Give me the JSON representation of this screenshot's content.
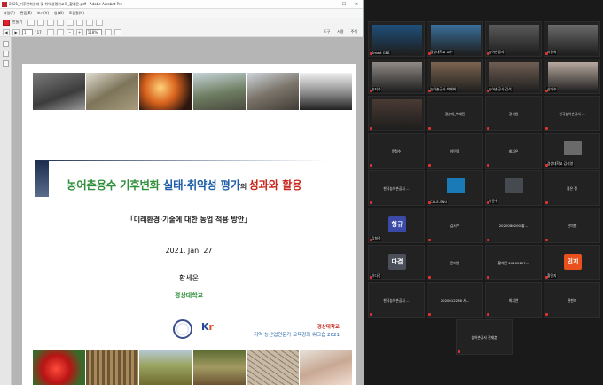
{
  "acrobat": {
    "title": "2021_기후변화실태 및 취약성평가교육_황세운.pdf - Adobe Acrobat Pro",
    "menu": [
      "파일(F)",
      "편집(E)",
      "보기(V)",
      "창(W)",
      "도움말(H)"
    ],
    "toolbar": {
      "create_label": "만들기",
      "page_current": "1",
      "page_total": "/ 17",
      "zoom": "118%",
      "right_items": [
        "도구",
        "서명",
        "주석"
      ]
    }
  },
  "slide": {
    "title_part1": "농어촌용수 기후변화 ",
    "title_part2": "실태·취약성 평가",
    "title_part3": "의 ",
    "title_part4": "성과와 활용",
    "subtitle": "「미래환경·기술에 대한 농업 적용 방안」",
    "date": "2021. Jan. 27",
    "author": "황세운",
    "affiliation": "경상대학교",
    "kr_logo_left": "K",
    "kr_logo_right": "r",
    "org_line1": "경상대학교",
    "org_line2": "지역 농산업전문가 교육강좌 워크숍 2021"
  },
  "zoom": {
    "tiles": [
      {
        "name": "Smart GBS",
        "type": "video",
        "color": "#1f4f7a"
      },
      {
        "name": "경상대학교 교수",
        "type": "video",
        "color": "#3a6f9a"
      },
      {
        "name": "농어촌공사",
        "type": "video",
        "color": "#5a5a5a"
      },
      {
        "name": "박중희",
        "type": "video",
        "color": "#6a6a6a"
      },
      {
        "name": "송지수",
        "type": "video",
        "color": "#8f8a86"
      },
      {
        "name": "농어촌공사 박재희",
        "type": "video",
        "color": "#7c6450"
      },
      {
        "name": "농어촌공사 김석",
        "type": "video",
        "color": "#6f5e53"
      },
      {
        "name": "신미수",
        "type": "video",
        "color": "#b8a9a0"
      },
      {
        "name": "",
        "type": "video",
        "color": "#4a3a33"
      },
      {
        "name": "경상대_박재민",
        "type": "name"
      },
      {
        "name": "강석원",
        "type": "name"
      },
      {
        "name": "한국농어촌공사 ...",
        "type": "name"
      },
      {
        "name": "문정수",
        "type": "name"
      },
      {
        "name": "이민정",
        "type": "name"
      },
      {
        "name": "최지은",
        "type": "name"
      },
      {
        "name": "경상대학교 김석영",
        "type": "thumb",
        "color": "#6a6a6a"
      },
      {
        "name": "한국농어촌공사 ...",
        "type": "name"
      },
      {
        "name": "CALE-SNU",
        "type": "thumb",
        "color": "#1a7ab8"
      },
      {
        "name": "이준우",
        "type": "thumb",
        "color": "#444a50"
      },
      {
        "name": "황은 정",
        "type": "name"
      },
      {
        "name": "김형주",
        "type": "badge",
        "badge": "형규",
        "color": "#3b4aa8"
      },
      {
        "name": "김시우",
        "type": "name"
      },
      {
        "name": "2020080200 황...",
        "type": "name"
      },
      {
        "name": "신미향",
        "type": "name"
      },
      {
        "name": "이다경",
        "type": "badge",
        "badge": "다겸",
        "color": "#4a4f5a"
      },
      {
        "name": "윤미현",
        "type": "name"
      },
      {
        "name": "황재민 20200127...",
        "type": "name"
      },
      {
        "name": "황민지",
        "type": "badge",
        "badge": "민지",
        "color": "#e8501e"
      },
      {
        "name": "한국농어촌공사 ...",
        "type": "name"
      },
      {
        "name": "2020012236 서...",
        "type": "name"
      },
      {
        "name": "최지연",
        "type": "name"
      },
      {
        "name": "권현지",
        "type": "name"
      },
      {
        "name": "농어촌공사 전재훈",
        "type": "name"
      }
    ]
  }
}
